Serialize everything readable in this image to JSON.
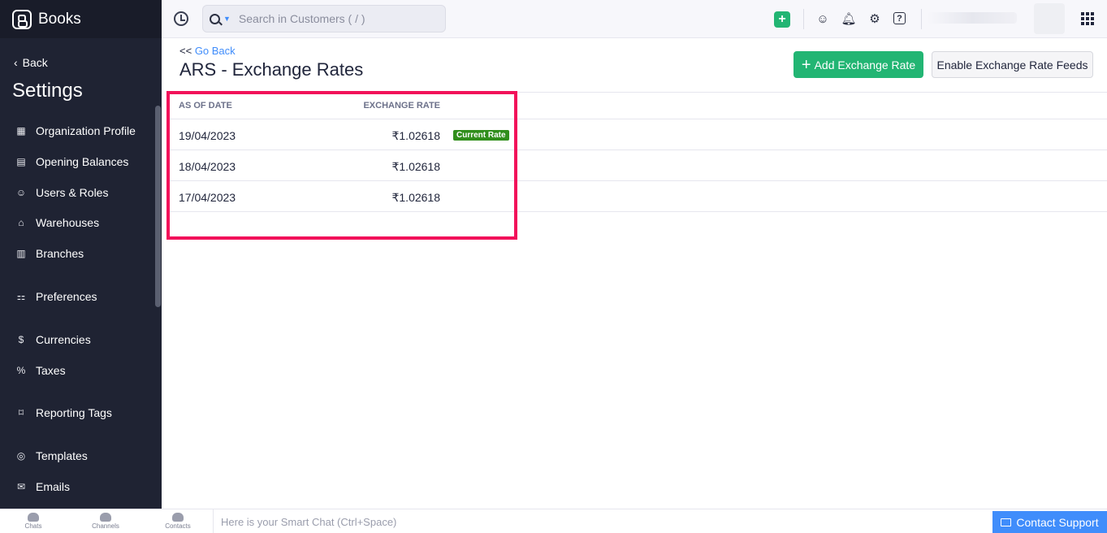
{
  "app": {
    "brand": "Books"
  },
  "sidebar": {
    "back_label": "Back",
    "title": "Settings",
    "items": [
      {
        "label": "Organization Profile",
        "icon": "building-icon"
      },
      {
        "label": "Opening Balances",
        "icon": "ledger-icon"
      },
      {
        "label": "Users & Roles",
        "icon": "users-icon"
      },
      {
        "label": "Warehouses",
        "icon": "warehouse-icon"
      },
      {
        "label": "Branches",
        "icon": "branch-icon"
      },
      {
        "label": "Preferences",
        "icon": "toggles-icon"
      },
      {
        "label": "Currencies",
        "icon": "currency-icon"
      },
      {
        "label": "Taxes",
        "icon": "percent-icon"
      },
      {
        "label": "Reporting Tags",
        "icon": "tag-icon"
      },
      {
        "label": "Templates",
        "icon": "palette-icon"
      },
      {
        "label": "Emails",
        "icon": "mail-icon"
      }
    ]
  },
  "topbar": {
    "search_placeholder": "Search in Customers ( / )"
  },
  "page": {
    "go_back_prefix": "<<",
    "go_back_label": "Go Back",
    "title": "ARS - Exchange Rates",
    "add_button": "Add Exchange Rate",
    "feeds_button": "Enable Exchange Rate Feeds"
  },
  "table": {
    "headers": {
      "date": "AS OF DATE",
      "rate": "EXCHANGE RATE"
    },
    "rows": [
      {
        "date": "19/04/2023",
        "rate": "₹1.02618",
        "badge": "Current Rate"
      },
      {
        "date": "18/04/2023",
        "rate": "₹1.02618"
      },
      {
        "date": "17/04/2023",
        "rate": "₹1.02618"
      }
    ]
  },
  "bottombar": {
    "chats": "Chats",
    "channels": "Channels",
    "contacts": "Contacts",
    "smart_chat": "Here is your Smart Chat (Ctrl+Space)",
    "contact_support": "Contact Support"
  },
  "colors": {
    "sidebar_bg": "#1f2333",
    "accent_green": "#22b573",
    "link_blue": "#408dfb",
    "highlight": "#f2115a",
    "badge_green": "#308e1b"
  }
}
